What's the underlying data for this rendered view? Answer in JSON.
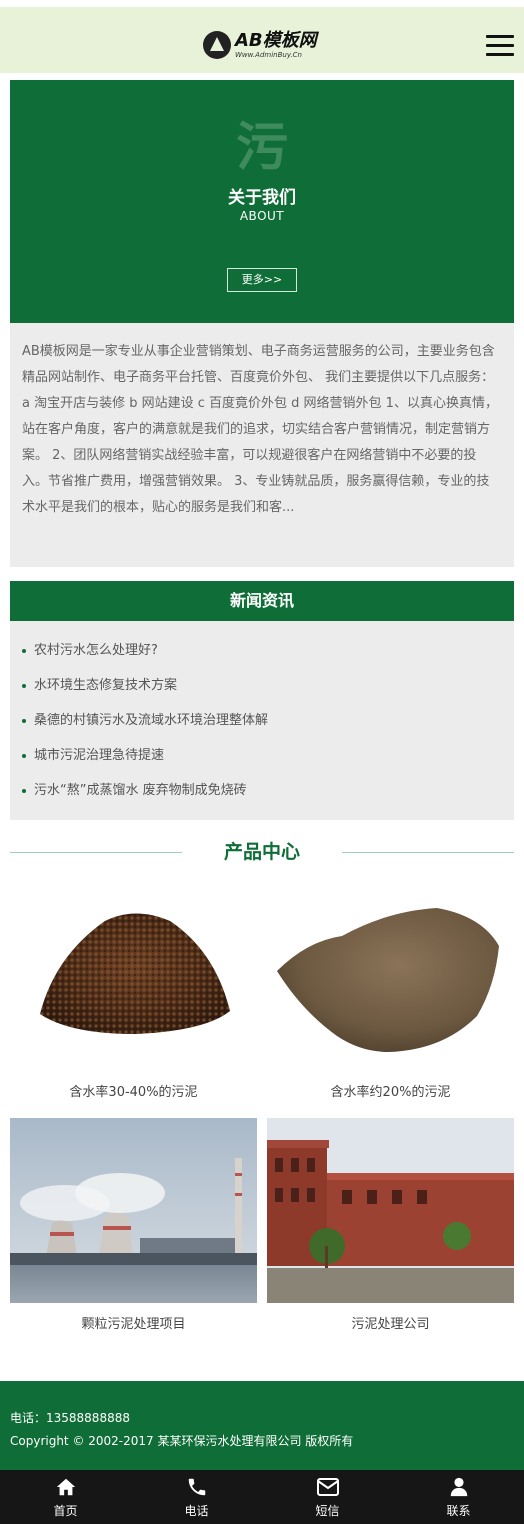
{
  "header": {
    "logo_main": "AB模板网",
    "logo_sub": "Www.AdminBuy.Cn"
  },
  "about": {
    "big_char": "污",
    "title": "关于我们",
    "subtitle": "ABOUT",
    "more_label": "更多>>",
    "text": "AB模板网是一家专业从事企业营销策划、电子商务运营服务的公司，主要业务包含精品网站制作、电子商务平台托管、百度竟价外包、 我们主要提供以下几点服务： a 淘宝开店与装修 b 网站建设 c 百度竟价外包 d 网络营销外包 1、以真心换真情，站在客户角度，客户的满意就是我们的追求，切实结合客户营销情况，制定营销方案。 2、团队网络营销实战经验丰富，可以规避很客户在网络营销中不必要的投入。节省推广费用，增强营销效果。 3、专业铸就品质，服务赢得信赖，专业的技术水平是我们的根本，贴心的服务是我们和客..."
  },
  "news": {
    "title": "新闻资讯",
    "items": [
      "农村污水怎么处理好?",
      "水环境生态修复技术方案",
      "桑德的村镇污水及流域水环境治理整体解",
      "城市污泥治理急待提速",
      "污水“熬”成蒸馏水 废弃物制成免烧砖"
    ]
  },
  "products": {
    "title": "产品中心",
    "items": [
      {
        "label": "含水率30-40%的污泥"
      },
      {
        "label": "含水率约20%的污泥"
      },
      {
        "label": "颗粒污泥处理项目"
      },
      {
        "label": "污泥处理公司"
      }
    ]
  },
  "footer": {
    "phone": "电话：13588888888",
    "copyright": "Copyright © 2002-2017 某某环保污水处理有限公司 版权所有"
  },
  "bottom_nav": [
    {
      "label": "首页",
      "icon": "home-icon"
    },
    {
      "label": "电话",
      "icon": "phone-icon"
    },
    {
      "label": "短信",
      "icon": "envelope-icon"
    },
    {
      "label": "联系",
      "icon": "user-icon"
    }
  ],
  "colors": {
    "brand_green": "#0f6e37",
    "header_bg": "#e8f2d9",
    "panel_bg": "#ececec",
    "nav_bg": "#161616"
  }
}
